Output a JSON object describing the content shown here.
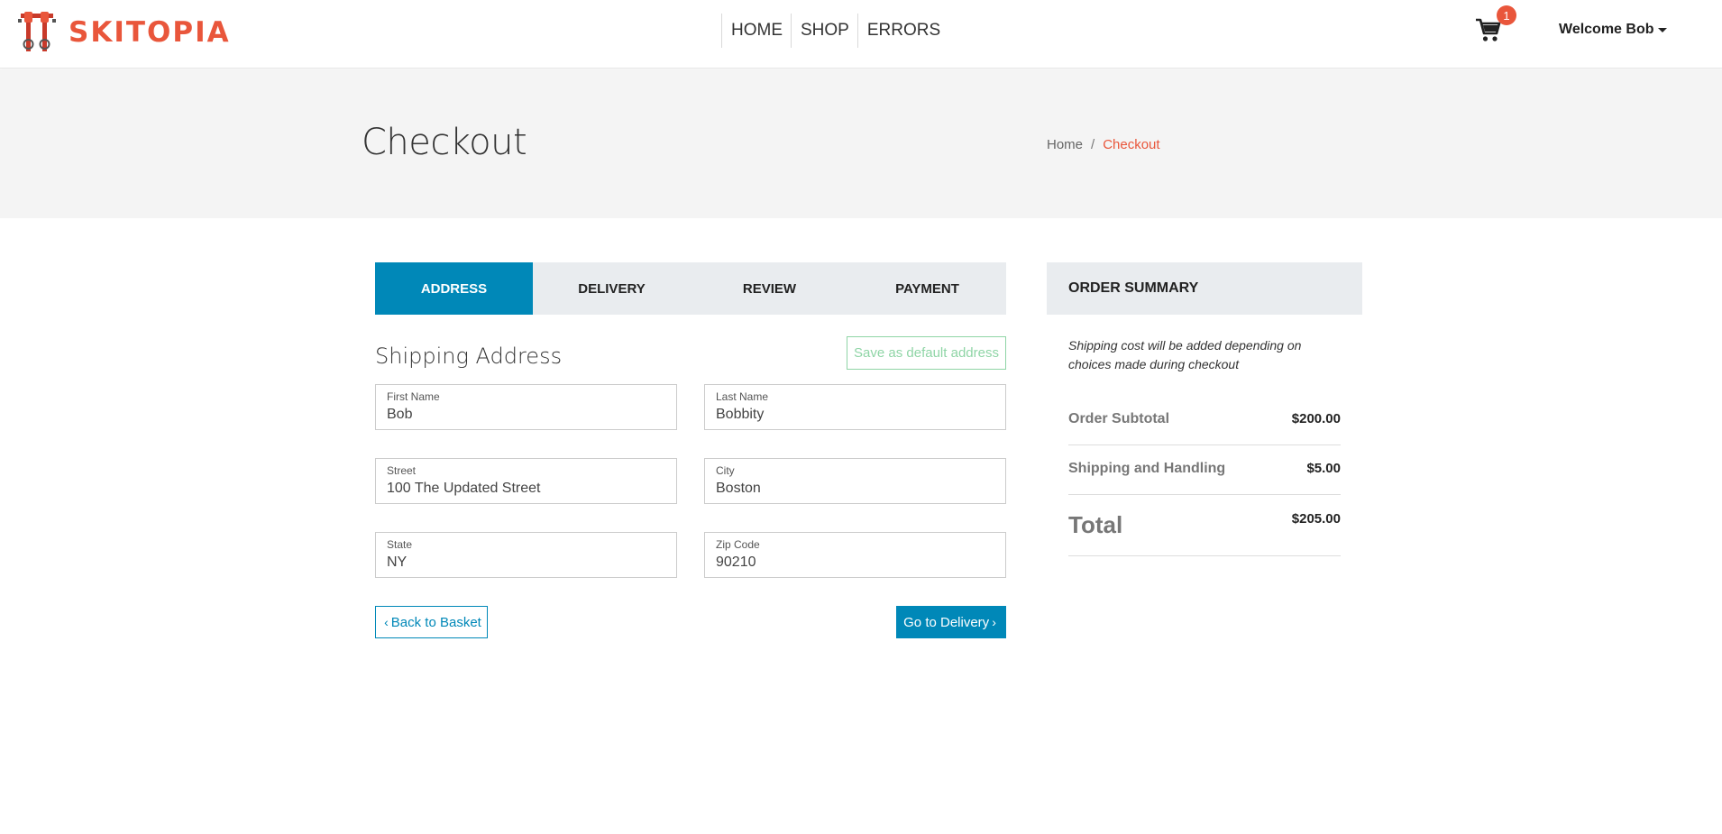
{
  "brand": {
    "name": "SKITOPIA",
    "accent": "#e9563b",
    "primary": "#0088b8",
    "success": "#8fd5a6"
  },
  "nav": {
    "items": [
      "HOME",
      "SHOP",
      "ERRORS"
    ]
  },
  "cart": {
    "icon": "cart-icon",
    "count": "1"
  },
  "user": {
    "welcome": "Welcome Bob"
  },
  "page": {
    "title": "Checkout"
  },
  "breadcrumb": {
    "home": "Home",
    "separator": "/",
    "current": "Checkout"
  },
  "steps": [
    {
      "label": "ADDRESS",
      "active": true
    },
    {
      "label": "DELIVERY",
      "active": false
    },
    {
      "label": "REVIEW",
      "active": false
    },
    {
      "label": "PAYMENT",
      "active": false
    }
  ],
  "shipping": {
    "title": "Shipping Address",
    "save_default": "Save as default address",
    "fields": {
      "first_name": {
        "label": "First Name",
        "value": "Bob"
      },
      "last_name": {
        "label": "Last Name",
        "value": "Bobbity"
      },
      "street": {
        "label": "Street",
        "value": "100 The Updated Street"
      },
      "city": {
        "label": "City",
        "value": "Boston"
      },
      "state": {
        "label": "State",
        "value": "NY"
      },
      "zip": {
        "label": "Zip Code",
        "value": "90210"
      }
    }
  },
  "buttons": {
    "back": "Back to Basket",
    "next": "Go to Delivery"
  },
  "summary": {
    "title": "ORDER SUMMARY",
    "note": "Shipping cost will be added depending on choices made during checkout",
    "subtotal_label": "Order Subtotal",
    "subtotal": "$200.00",
    "shipping_label": "Shipping and Handling",
    "shipping": "$5.00",
    "total_label": "Total",
    "total": "$205.00"
  }
}
